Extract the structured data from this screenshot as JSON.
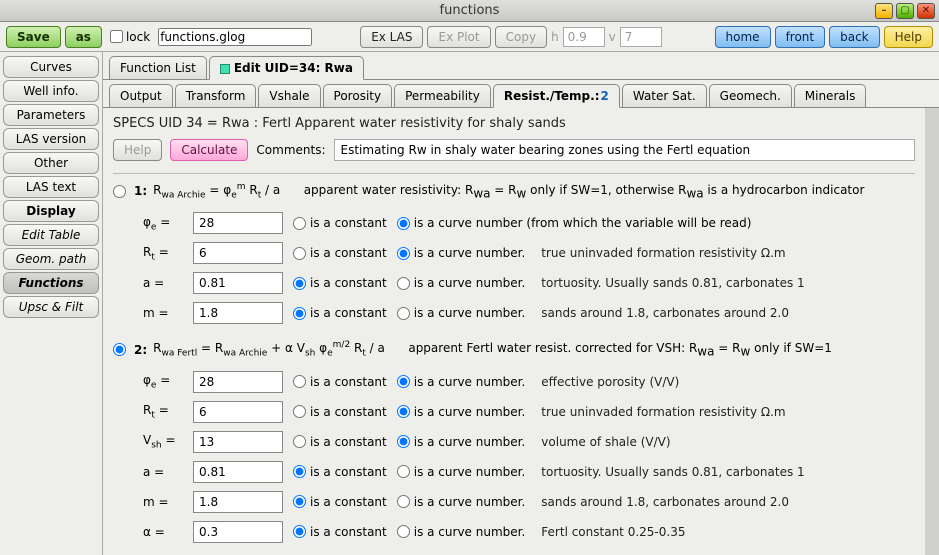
{
  "window": {
    "title": "functions"
  },
  "toolbar": {
    "save": "Save",
    "as": "as",
    "lock": "lock",
    "filename": "functions.glog",
    "exlas": "Ex LAS",
    "explot": "Ex Plot",
    "copy": "Copy",
    "h_label": "h",
    "h_value": "0.9",
    "v_label": "v",
    "v_value": "7",
    "home": "home",
    "front": "front",
    "back": "back",
    "help": "Help"
  },
  "sidebar": {
    "items": [
      "Curves",
      "Well info.",
      "Parameters",
      "LAS version",
      "Other",
      "LAS text",
      "Display",
      "Edit Table",
      "Geom. path",
      "Functions",
      "Upsc & Filt"
    ]
  },
  "tabs_top": {
    "list": "Function List",
    "edit": "Edit UID=34: Rwa"
  },
  "tabs_sub": [
    "Output",
    "Transform",
    "Vshale",
    "Porosity",
    "Permeability",
    "Resist./Temp.:",
    "Water Sat.",
    "Geomech.",
    "Minerals"
  ],
  "tabs_sub_badge": "2",
  "panel": {
    "specs": "SPECS UID 34 = Rwa : Fertl Apparent water resistivity for shaly sands",
    "help": "Help",
    "calculate": "Calculate",
    "comments_label": "Comments:",
    "comments_value": "Estimating Rw in shaly water bearing zones using the Fertl equation"
  },
  "labels": {
    "is_constant": "is a constant",
    "is_curve": "is a curve number",
    "is_curve_dot": "is a curve number.",
    "is_curve_long": "is a curve number (from which the variable will be read)"
  },
  "section1": {
    "num": "1:",
    "desc_head": "apparent water resistivity: R",
    "desc_tail": " only if SW=1, otherwise R",
    "desc_end": " is a hydrocarbon indicator",
    "params": {
      "phi_e": {
        "value": "28",
        "mode": "curve"
      },
      "Rt": {
        "value": "6",
        "mode": "curve",
        "desc": "true uninvaded formation resistivity Ω.m"
      },
      "a": {
        "value": "0.81",
        "mode": "const",
        "desc": "tortuosity. Usually sands 0.81, carbonates 1"
      },
      "m": {
        "value": "1.8",
        "mode": "const",
        "desc": "sands around 1.8, carbonates around 2.0"
      }
    }
  },
  "section2": {
    "num": "2:",
    "desc": "apparent Fertl water resist. corrected for VSH: R",
    "desc_tail": " only if SW=1",
    "params": {
      "phi_e": {
        "value": "28",
        "mode": "curve",
        "desc": "effective porosity (V/V)"
      },
      "Rt": {
        "value": "6",
        "mode": "curve",
        "desc": "true uninvaded formation resistivity Ω.m"
      },
      "Vsh": {
        "value": "13",
        "mode": "curve",
        "desc": "volume of shale (V/V)"
      },
      "a": {
        "value": "0.81",
        "mode": "const",
        "desc": "tortuosity. Usually sands 0.81, carbonates 1"
      },
      "m": {
        "value": "1.8",
        "mode": "const",
        "desc": "sands around 1.8, carbonates around 2.0"
      },
      "alpha": {
        "value": "0.3",
        "mode": "const",
        "desc": "Fertl constant 0.25-0.35"
      }
    }
  }
}
